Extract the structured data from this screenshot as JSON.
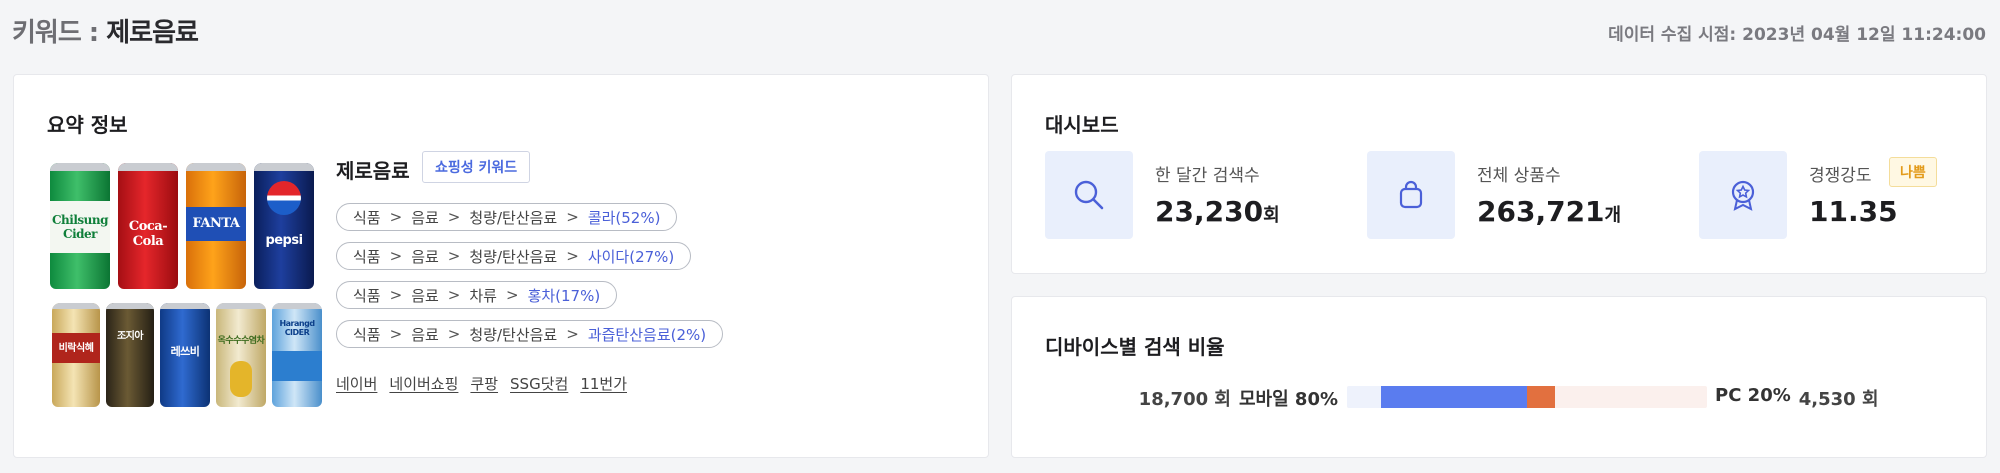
{
  "header": {
    "prefix": "키워드 : ",
    "keyword": "제로음료",
    "collected_at": "데이터 수집 시점: 2023년 04월 12일 11:24:00"
  },
  "summary": {
    "heading": "요약 정보",
    "product_name": "제로음료",
    "tag": "쇼핑성 키워드",
    "can_labels": [
      "Chilsung Cider",
      "Coca-Cola",
      "FANTA",
      "pepsi",
      "비락식혜",
      "조지아",
      "레쓰비",
      "옥수수수염차",
      "Harangd CIDER"
    ],
    "categories": [
      {
        "path": [
          "식품",
          "음료",
          "청량/탄산음료"
        ],
        "leaf": "콜라(52%)"
      },
      {
        "path": [
          "식품",
          "음료",
          "청량/탄산음료"
        ],
        "leaf": "사이다(27%)"
      },
      {
        "path": [
          "식품",
          "음료",
          "차류"
        ],
        "leaf": "홍차(17%)"
      },
      {
        "path": [
          "식품",
          "음료",
          "청량/탄산음료"
        ],
        "leaf": "과즙탄산음료(2%)"
      }
    ],
    "separator": ">",
    "links": [
      "네이버",
      "네이버쇼핑",
      "쿠팡",
      "SSG닷컴",
      "11번가"
    ]
  },
  "dashboard": {
    "heading": "대시보드",
    "stats": [
      {
        "label": "한 달간 검색수",
        "value": "23,230",
        "unit": "회",
        "icon": "search-icon"
      },
      {
        "label": "전체 상품수",
        "value": "263,721",
        "unit": "개",
        "icon": "shopping-bag-icon"
      },
      {
        "label": "경쟁강도",
        "value": "11.35",
        "unit": "",
        "badge": "나쁨",
        "icon": "award-icon"
      }
    ]
  },
  "device": {
    "heading": "디바이스별 검색 비율",
    "mobile_count": "18,700 회",
    "mobile_label": "모바일 80%",
    "pc_label": "PC 20%",
    "pc_count": "4,530 회",
    "mobile_share": 0.8,
    "pc_share": 0.2
  },
  "colors": {
    "accent": "#4b60d8",
    "mobile_bar": "#5a7cef",
    "pc_bar": "#e2703f",
    "badge_bad": "#e39b1a"
  }
}
